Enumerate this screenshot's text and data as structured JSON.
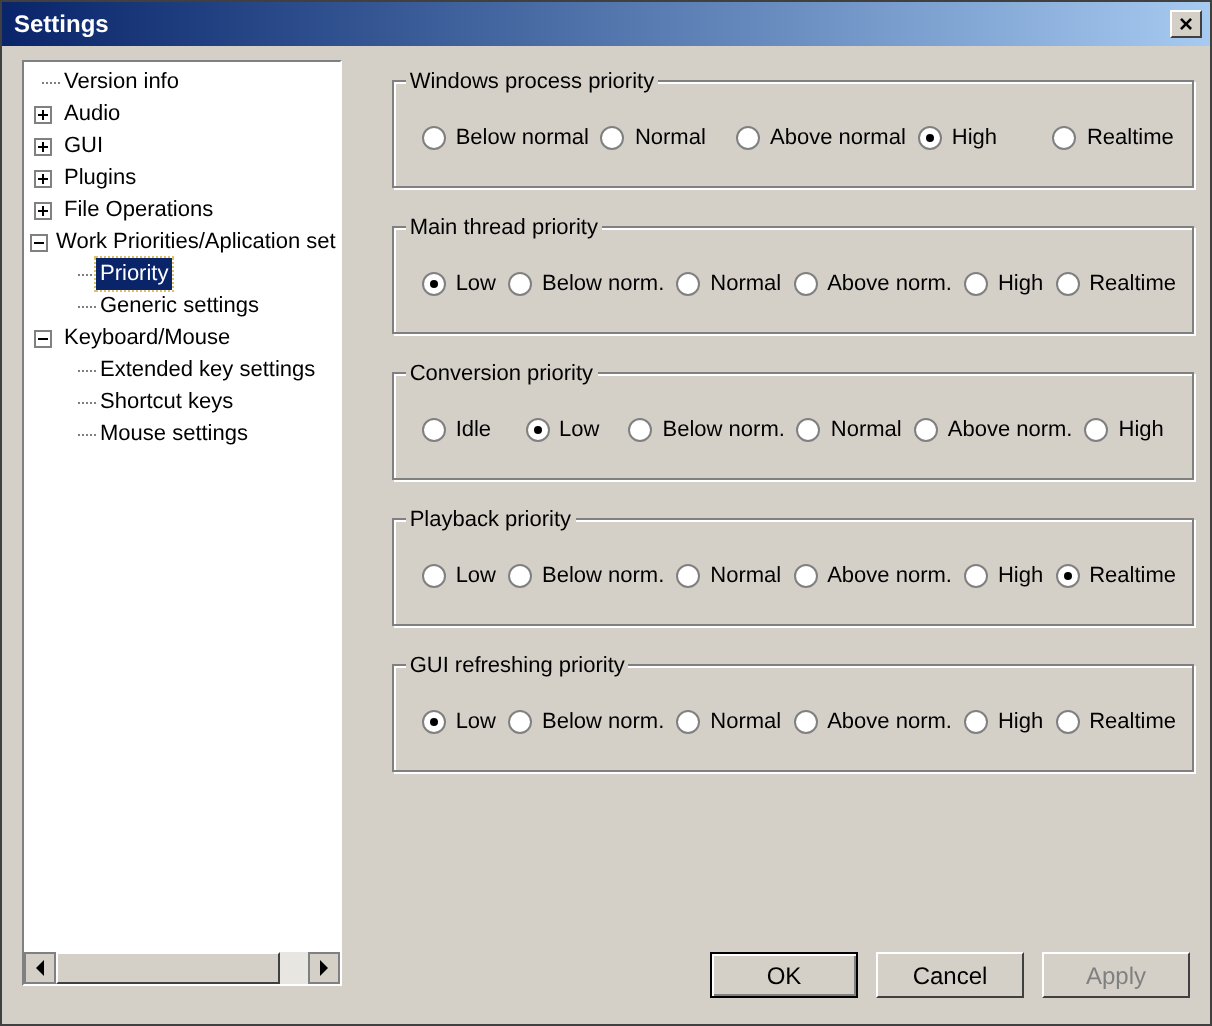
{
  "window": {
    "title": "Settings",
    "close": "×"
  },
  "tree": [
    {
      "label": "Version info",
      "selected": false
    },
    {
      "label": "Audio",
      "expanded": false,
      "selected": false
    },
    {
      "label": "GUI",
      "expanded": false,
      "selected": false
    },
    {
      "label": "Plugins",
      "expanded": false,
      "selected": false
    },
    {
      "label": "File Operations",
      "expanded": false,
      "selected": false
    },
    {
      "label": "Work Priorities/Aplication set",
      "expanded": true,
      "selected": false,
      "children": [
        {
          "label": "Priority",
          "selected": true
        },
        {
          "label": "Generic settings",
          "selected": false
        }
      ]
    },
    {
      "label": "Keyboard/Mouse",
      "expanded": true,
      "selected": false,
      "children": [
        {
          "label": "Extended key settings",
          "selected": false
        },
        {
          "label": "Shortcut keys",
          "selected": false
        },
        {
          "label": "Mouse settings",
          "selected": false
        }
      ]
    }
  ],
  "groups": [
    {
      "title": "Windows process priority",
      "options": [
        {
          "label": "Below normal",
          "selected": false
        },
        {
          "label": "Normal",
          "selected": false
        },
        {
          "label": "Above normal",
          "selected": false
        },
        {
          "label": "High",
          "selected": true
        },
        {
          "label": "Realtime",
          "selected": false
        }
      ]
    },
    {
      "title": "Main thread priority",
      "options": [
        {
          "label": "Low",
          "selected": true
        },
        {
          "label": "Below norm.",
          "selected": false
        },
        {
          "label": "Normal",
          "selected": false
        },
        {
          "label": "Above norm.",
          "selected": false
        },
        {
          "label": "High",
          "selected": false
        },
        {
          "label": "Realtime",
          "selected": false
        }
      ]
    },
    {
      "title": "Conversion priority",
      "options": [
        {
          "label": "Idle",
          "selected": false
        },
        {
          "label": "Low",
          "selected": true
        },
        {
          "label": "Below norm.",
          "selected": false
        },
        {
          "label": "Normal",
          "selected": false
        },
        {
          "label": "Above norm.",
          "selected": false
        },
        {
          "label": "High",
          "selected": false
        }
      ]
    },
    {
      "title": "Playback priority",
      "options": [
        {
          "label": "Low",
          "selected": false
        },
        {
          "label": "Below norm.",
          "selected": false
        },
        {
          "label": "Normal",
          "selected": false
        },
        {
          "label": "Above norm.",
          "selected": false
        },
        {
          "label": "High",
          "selected": false
        },
        {
          "label": "Realtime",
          "selected": true
        }
      ]
    },
    {
      "title": "GUI refreshing priority",
      "options": [
        {
          "label": "Low",
          "selected": true
        },
        {
          "label": "Below norm.",
          "selected": false
        },
        {
          "label": "Normal",
          "selected": false
        },
        {
          "label": "Above norm.",
          "selected": false
        },
        {
          "label": "High",
          "selected": false
        },
        {
          "label": "Realtime",
          "selected": false
        }
      ]
    }
  ],
  "buttons": [
    {
      "label": "OK",
      "disabled": false,
      "default": true
    },
    {
      "label": "Cancel",
      "disabled": false,
      "default": false
    },
    {
      "label": "Apply",
      "disabled": true,
      "default": false
    }
  ]
}
